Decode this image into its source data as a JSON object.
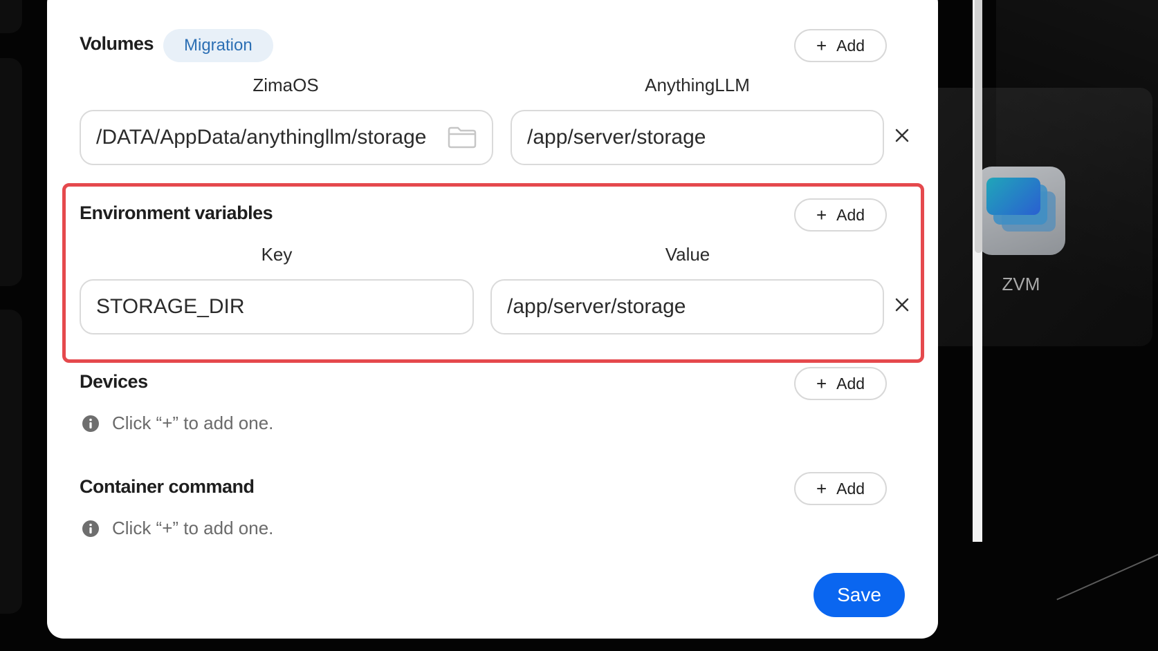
{
  "desktop": {
    "app_tile": {
      "label": "ZVM",
      "icon": "zvm-app-icon"
    }
  },
  "volumes": {
    "title": "Volumes",
    "badge": "Migration",
    "add_label": "Add",
    "host_header": "ZimaOS",
    "container_header": "AnythingLLM",
    "rows": [
      {
        "host": "/DATA/AppData/anythingllm/storage",
        "container": "/app/server/storage"
      }
    ]
  },
  "env": {
    "title": "Environment variables",
    "add_label": "Add",
    "key_header": "Key",
    "value_header": "Value",
    "rows": [
      {
        "key": "STORAGE_DIR",
        "value": "/app/server/storage"
      }
    ],
    "highlight_color": "#e5494d"
  },
  "devices": {
    "title": "Devices",
    "add_label": "Add",
    "hint": "Click “+” to add one."
  },
  "container_command": {
    "title": "Container command",
    "add_label": "Add",
    "hint": "Click “+” to add one."
  },
  "footer": {
    "save_label": "Save",
    "save_color": "#0a66f0"
  }
}
